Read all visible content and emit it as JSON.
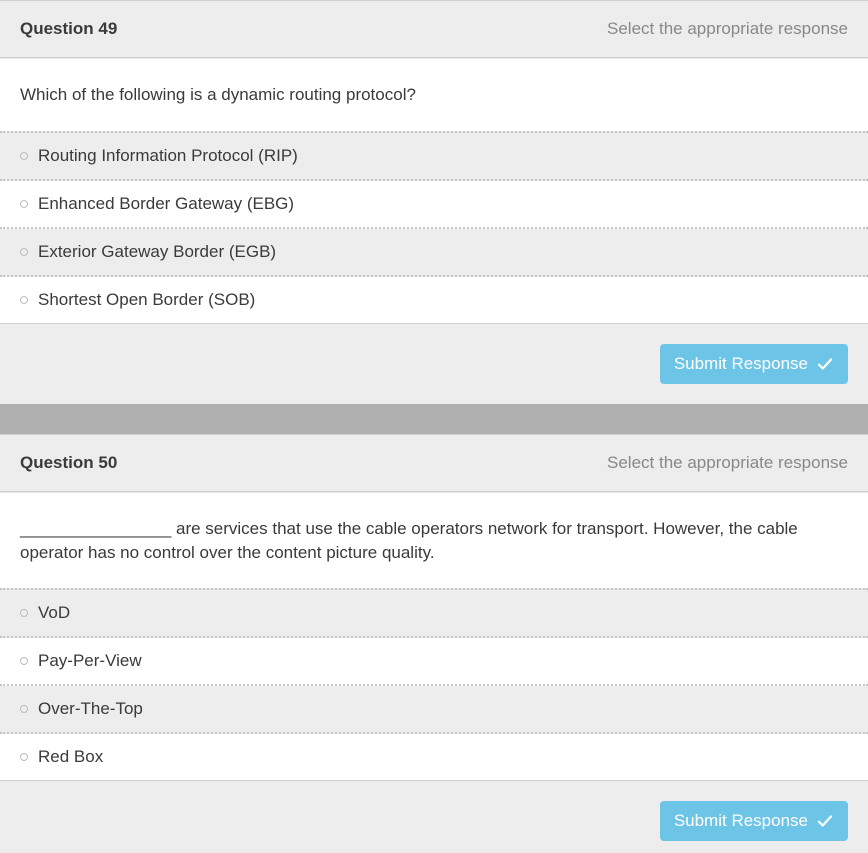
{
  "instruction": "Select the appropriate response",
  "submit_label": "Submit Response",
  "questions": [
    {
      "title": "Question 49",
      "prompt": "Which of the following is a dynamic routing protocol?",
      "options": [
        "Routing Information Protocol (RIP)",
        "Enhanced Border Gateway (EBG)",
        "Exterior Gateway Border (EGB)",
        "Shortest Open Border (SOB)"
      ]
    },
    {
      "title": "Question 50",
      "prompt": "________________ are services that use the cable operators network for transport. However, the cable operator has no control over the content picture quality.",
      "options": [
        "VoD",
        "Pay-Per-View",
        "Over-The-Top",
        "Red Box"
      ]
    }
  ]
}
